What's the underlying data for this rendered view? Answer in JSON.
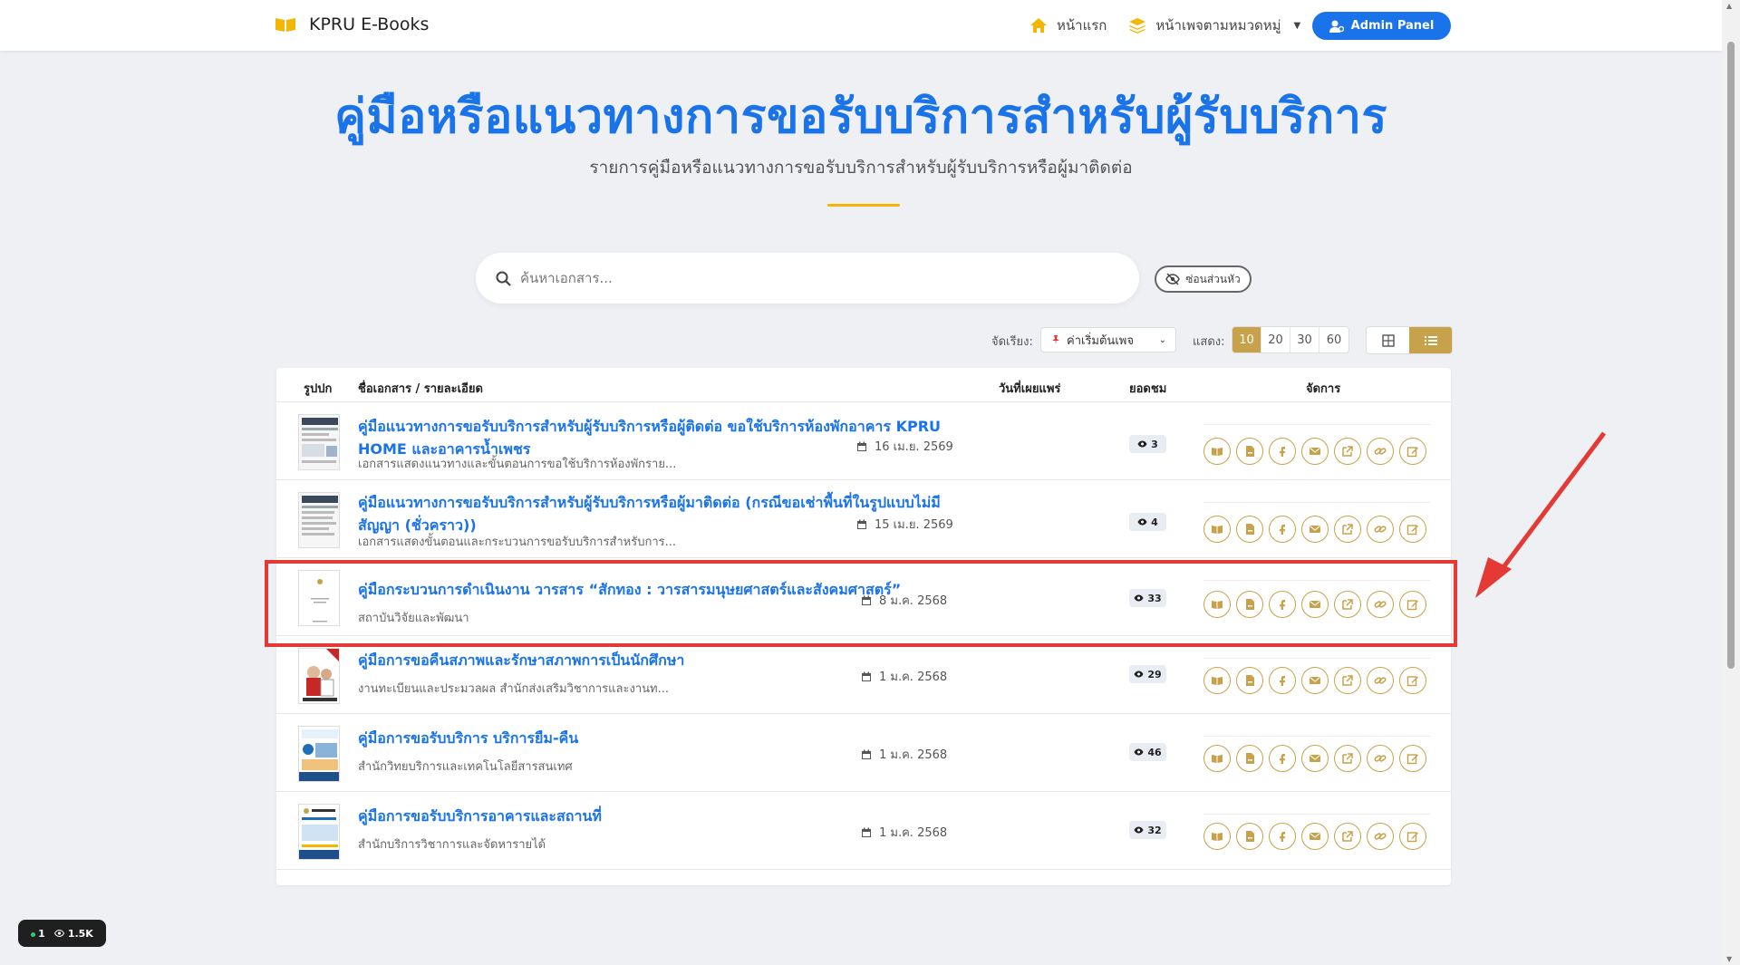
{
  "navbar": {
    "brand": "KPRU E-Books",
    "home_label": "หน้าแรก",
    "categories_label": "หน้าเพจตามหมวดหมู่",
    "admin_label": "Admin Panel"
  },
  "hero": {
    "title": "คู่มือหรือแนวทางการขอรับบริการสำหรับผู้รับบริการ",
    "subtitle": "รายการคู่มือหรือแนวทางการขอรับบริการสำหรับผู้รับบริการหรือผู้มาติดต่อ"
  },
  "search": {
    "placeholder": "ค้นหาเอกสาร..."
  },
  "hide_header_label": "ซ่อนส่วนหัว",
  "toolbar": {
    "sort_label": "จัดเรียง:",
    "sort_value": "ค่าเริ่มต้นเพจ",
    "show_label": "แสดง:",
    "page_sizes": [
      "10",
      "20",
      "30",
      "60"
    ],
    "active_page_size": "10"
  },
  "table": {
    "headers": {
      "cover": "รูปปก",
      "name": "ชื่อเอกสาร / รายละเอียด",
      "date": "วันที่เผยแพร่",
      "views": "ยอดชม",
      "manage": "จัดการ"
    },
    "rows": [
      {
        "title": "คู่มือแนวทางการขอรับบริการสำหรับผู้รับบริการหรือผู้ติดต่อ ขอใช้บริการห้องพักอาคาร KPRU HOME และอาคารน้ำเพชร",
        "desc": "เอกสารแสดงแนวทางและขั้นตอนการขอใช้บริการห้องพักราย...",
        "date": "16 เม.ย. 2569",
        "views": "3"
      },
      {
        "title": "คู่มือแนวทางการขอรับบริการสำหรับผู้รับบริการหรือผู้มาติดต่อ (กรณีขอเช่าพื้นที่ในรูปแบบไม่มีสัญญา (ชั่วคราว))",
        "desc": "เอกสารแสดงขั้นตอนและกระบวนการขอรับบริการสำหรับการ...",
        "date": "15 เม.ย. 2569",
        "views": "4"
      },
      {
        "title": "คู่มือกระบวนการดำเนินงาน วารสาร “สักทอง : วารสารมนุษยศาสตร์และสังคมศาสตร์”",
        "desc": "สถาบันวิจัยและพัฒนา",
        "date": "8 ม.ค. 2568",
        "views": "33"
      },
      {
        "title": "คู่มือการขอคืนสภาพและรักษาสภาพการเป็นนักศึกษา",
        "desc": "งานทะเบียนและประมวลผล สำนักส่งเสริมวิชาการและงานท...",
        "date": "1 ม.ค. 2568",
        "views": "29"
      },
      {
        "title": "คู่มือการขอรับบริการ บริการยืม-คืน",
        "desc": "สำนักวิทยบริการและเทคโนโลยีสารสนเทศ",
        "date": "1 ม.ค. 2568",
        "views": "46"
      },
      {
        "title": "คู่มือการขอรับบริการอาคารและสถานที่",
        "desc": "สำนักบริการวิชาการและจัดหารายได้",
        "date": "1 ม.ค. 2568",
        "views": "32"
      }
    ]
  },
  "stats": {
    "online": "1",
    "views": "1.5K"
  },
  "colors": {
    "primary": "#1a73e8",
    "gold": "#c8a24a",
    "highlight": "#e53935"
  }
}
